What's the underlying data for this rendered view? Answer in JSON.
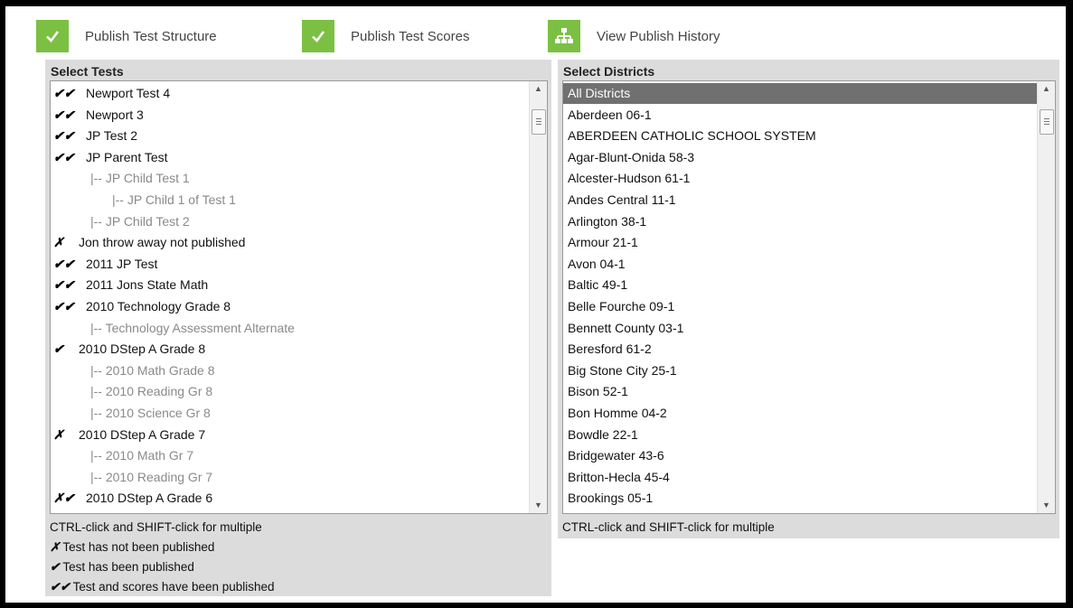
{
  "toolbar": {
    "publish_structure": "Publish Test Structure",
    "publish_scores": "Publish Test Scores",
    "view_history": "View Publish History"
  },
  "colors": {
    "icon_green": "#7bc043",
    "selected_row": "#707070",
    "panel_bg": "#dcdcdc"
  },
  "tests_panel": {
    "title": "Select Tests",
    "help": "CTRL-click and SHIFT-click for multiple",
    "items": [
      {
        "mark": "✔✔",
        "label": "Newport Test 4",
        "child": false
      },
      {
        "mark": "✔✔",
        "label": "Newport 3",
        "child": false
      },
      {
        "mark": "✔✔",
        "label": "JP Test 2",
        "child": false
      },
      {
        "mark": "✔✔",
        "label": "JP Parent Test",
        "child": false
      },
      {
        "mark": "",
        "label": "|-- JP Child Test 1",
        "child": true,
        "indent": 1
      },
      {
        "mark": "",
        "label": "|-- JP Child 1 of Test 1",
        "child": true,
        "indent": 2
      },
      {
        "mark": "",
        "label": "|-- JP Child Test 2",
        "child": true,
        "indent": 1
      },
      {
        "mark": "✗",
        "label": "Jon throw away not published",
        "child": false
      },
      {
        "mark": "✔✔",
        "label": "2011 JP Test",
        "child": false
      },
      {
        "mark": "✔✔",
        "label": "2011 Jons State Math",
        "child": false
      },
      {
        "mark": "✔✔",
        "label": "2010 Technology Grade 8",
        "child": false
      },
      {
        "mark": "",
        "label": "|-- Technology Assessment Alternate",
        "child": true,
        "indent": 1
      },
      {
        "mark": "✔",
        "label": "2010 DStep A Grade 8",
        "child": false
      },
      {
        "mark": "",
        "label": "|-- 2010 Math Grade 8",
        "child": true,
        "indent": 1
      },
      {
        "mark": "",
        "label": "|-- 2010 Reading Gr 8",
        "child": true,
        "indent": 1
      },
      {
        "mark": "",
        "label": "|-- 2010 Science Gr 8",
        "child": true,
        "indent": 1
      },
      {
        "mark": "✗",
        "label": "2010 DStep A Grade 7",
        "child": false
      },
      {
        "mark": "",
        "label": "|-- 2010 Math Gr 7",
        "child": true,
        "indent": 1
      },
      {
        "mark": "",
        "label": "|-- 2010 Reading Gr 7",
        "child": true,
        "indent": 1
      },
      {
        "mark": "✗✔",
        "label": "2010 DStep A Grade 6",
        "child": false
      }
    ],
    "legend": [
      {
        "mark": "✗",
        "text": "Test has not been published"
      },
      {
        "mark": "✔",
        "text": "Test has been published"
      },
      {
        "mark": "✔✔",
        "text": "Test and scores have been published"
      }
    ]
  },
  "districts_panel": {
    "title": "Select Districts",
    "help": "CTRL-click and SHIFT-click for multiple",
    "items": [
      "All Districts",
      "Aberdeen 06-1",
      "ABERDEEN CATHOLIC SCHOOL SYSTEM",
      "Agar-Blunt-Onida 58-3",
      "Alcester-Hudson 61-1",
      "Andes Central 11-1",
      "Arlington 38-1",
      "Armour 21-1",
      "Avon 04-1",
      "Baltic 49-1",
      "Belle Fourche 09-1",
      "Bennett County 03-1",
      "Beresford 61-2",
      "Big Stone City 25-1",
      "Bison 52-1",
      "Bon Homme 04-2",
      "Bowdle 22-1",
      "Bridgewater 43-6",
      "Britton-Hecla 45-4",
      "Brookings 05-1"
    ],
    "selected_index": 0
  }
}
